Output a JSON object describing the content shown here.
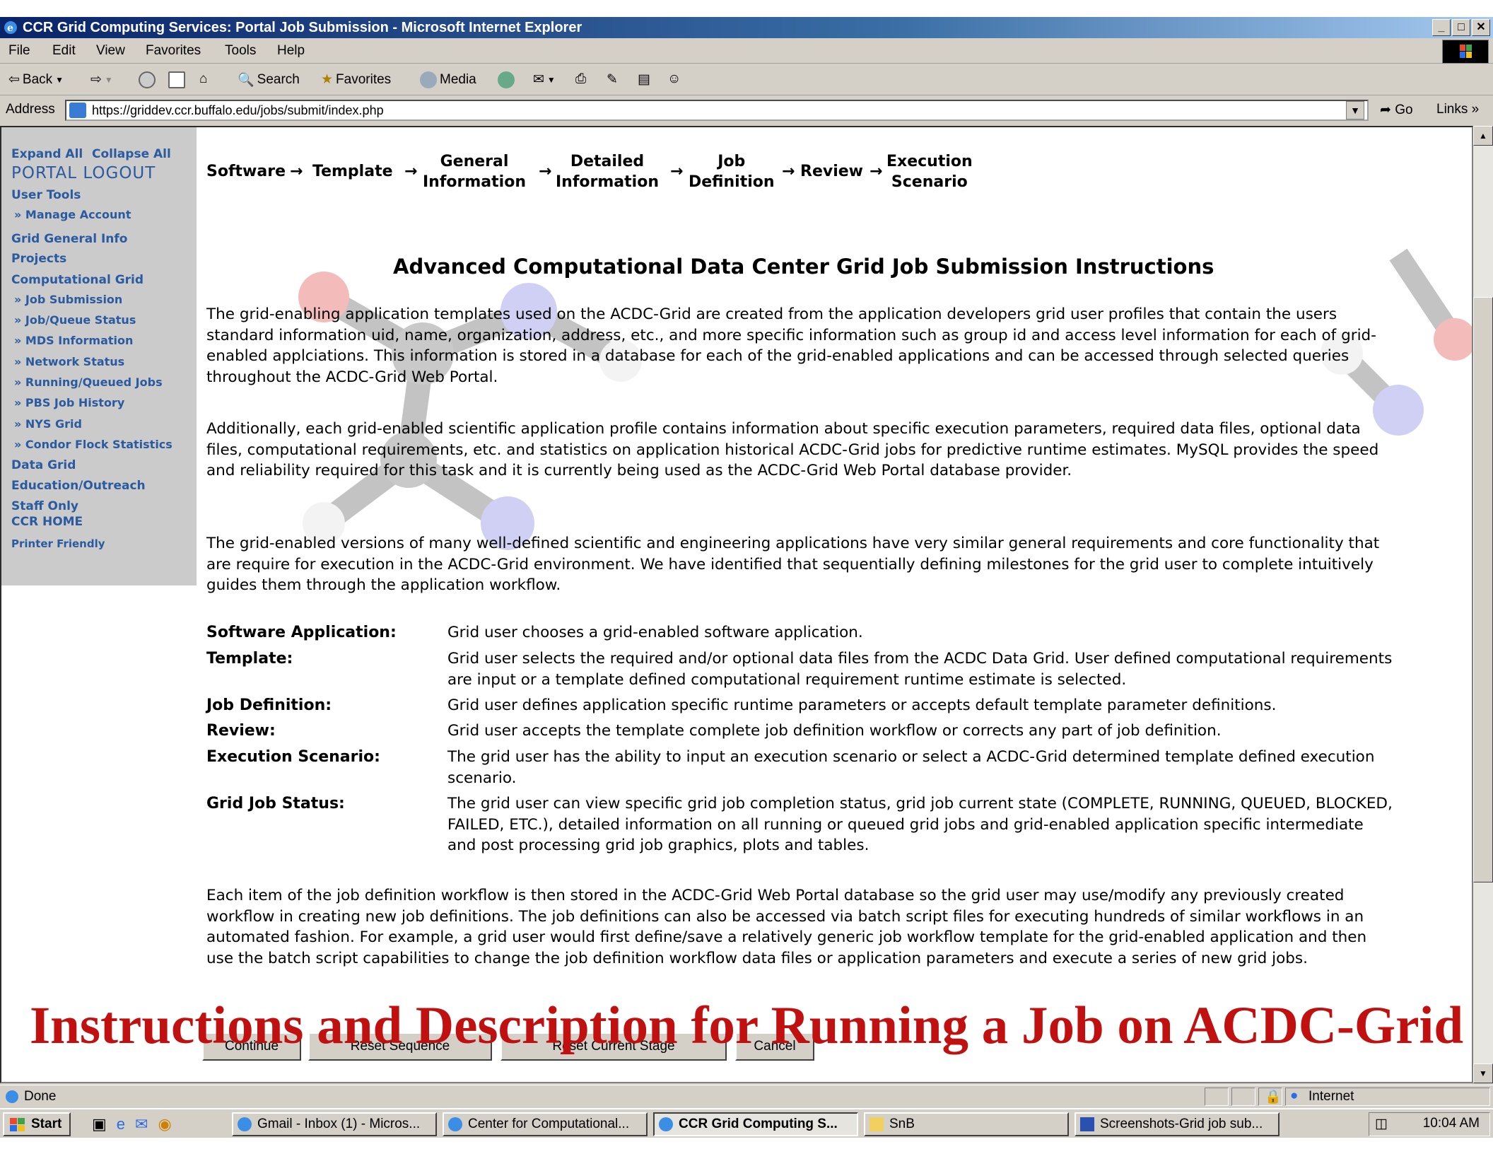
{
  "window": {
    "title": "CCR Grid Computing Services: Portal Job Submission - Microsoft Internet Explorer",
    "min_label": "_",
    "max_label": "□",
    "close_label": "✕"
  },
  "menubar": {
    "items": [
      "File",
      "Edit",
      "View",
      "Favorites",
      "Tools",
      "Help"
    ]
  },
  "toolbar": {
    "back_label": "Back",
    "search_label": "Search",
    "favorites_label": "Favorites",
    "media_label": "Media"
  },
  "addressbar": {
    "label": "Address",
    "url": "https://griddev.ccr.buffalo.edu/jobs/submit/index.php",
    "go_label": "Go",
    "links_label": "Links »"
  },
  "sidebar": {
    "expand_all": "Expand All",
    "collapse_all": "Collapse All",
    "logout": "PORTAL LOGOUT",
    "user_tools": "User Tools",
    "manage_account": "» Manage Account",
    "grid_general_info": "Grid General Info",
    "projects": "Projects",
    "computational_grid": "Computational Grid",
    "sub_items": [
      "» Job Submission",
      "» Job/Queue Status",
      "» MDS Information",
      "» Network Status",
      "» Running/Queued Jobs",
      "» PBS Job History",
      "» NYS Grid",
      "» Condor Flock Statistics"
    ],
    "data_grid": "Data Grid",
    "education_outreach": "Education/Outreach",
    "staff_only": "Staff Only",
    "ccr_home": "CCR HOME",
    "printer_friendly": "Printer Friendly"
  },
  "breadcrumb": {
    "steps": [
      [
        "Software"
      ],
      [
        "Template"
      ],
      [
        "General",
        "Information"
      ],
      [
        "Detailed",
        "Information"
      ],
      [
        "Job",
        "Definition"
      ],
      [
        "Review"
      ],
      [
        "Execution",
        "Scenario"
      ]
    ],
    "arrow": "→"
  },
  "main": {
    "heading": "Advanced Computational Data Center Grid Job Submission Instructions",
    "paragraphs": [
      "The grid-enabling application templates used on the ACDC-Grid are created from the application developers grid user profiles that contain the users standard information uid, name, organization, address, etc., and more specific information such as group id and access level information for each of grid-enabled applciations. This information is stored in a database for each of the grid-enabled applications and can be accessed through selected queries throughout the ACDC-Grid Web Portal.",
      "Additionally, each grid-enabled scientific application profile contains information about specific execution parameters, required data files, optional data files, computational requirements, etc. and statistics on application historical ACDC-Grid jobs for predictive runtime estimates. MySQL provides the speed and reliability required for this task and it is currently being used as the ACDC-Grid Web Portal database provider.",
      "The grid-enabled versions of many well-defined scientific and engineering applications have very similar general requirements and core functionality that are require for execution in the ACDC-Grid environment. We have identified that sequentially defining milestones for the grid user to complete intuitively guides them through the application workflow."
    ],
    "definitions": [
      {
        "term": "Software Application:",
        "desc": "Grid user chooses a grid-enabled software application."
      },
      {
        "term": "Template:",
        "desc": "Grid user selects the required and/or optional data files from the ACDC Data Grid. User defined computational requirements are input or a template defined computational requirement runtime estimate is selected."
      },
      {
        "term": "Job Definition:",
        "desc": "Grid user defines application specific runtime parameters or accepts default template parameter definitions."
      },
      {
        "term": "Review:",
        "desc": "Grid user accepts the template complete job definition workflow or corrects any part of job definition."
      },
      {
        "term": "Execution Scenario:",
        "desc": "The grid user has the ability to input an execution scenario or select a ACDC-Grid determined template defined execution scenario."
      },
      {
        "term": "Grid Job Status:",
        "desc": "The grid user can view specific grid job completion status, grid job current state (COMPLETE, RUNNING, QUEUED, BLOCKED, FAILED, ETC.), detailed information on all running or queued grid jobs and grid-enabled application specific intermediate and post processing grid job graphics, plots and tables."
      }
    ],
    "closing": "Each item of the job definition workflow is then stored in the ACDC-Grid Web Portal database so the grid user may use/modify any previously created workflow in creating new job definitions. The job definitions can also be accessed via batch script files for executing hundreds of similar workflows in an automated fashion. For example, a grid user would first define/save a relatively generic job workflow template for the grid-enabled application and then use the batch script capabilities to change the job definition workflow data files or application parameters and execute a series of new grid jobs."
  },
  "buttons": {
    "continue": "Continue",
    "reset_sequence": "Reset Sequence",
    "reset_current_stage": "Reset Current Stage",
    "cancel": "Cancel"
  },
  "status": {
    "text": "Done",
    "zone": "Internet"
  },
  "taskbar": {
    "start": "Start",
    "tasks": [
      "Gmail - Inbox (1) - Micros...",
      "Center for Computational...",
      "CCR Grid Computing S...",
      "SnB",
      "Screenshots-Grid job sub..."
    ],
    "clock": "10:04 AM"
  },
  "caption": "Instructions and Description for Running a Job on ACDC-Grid"
}
